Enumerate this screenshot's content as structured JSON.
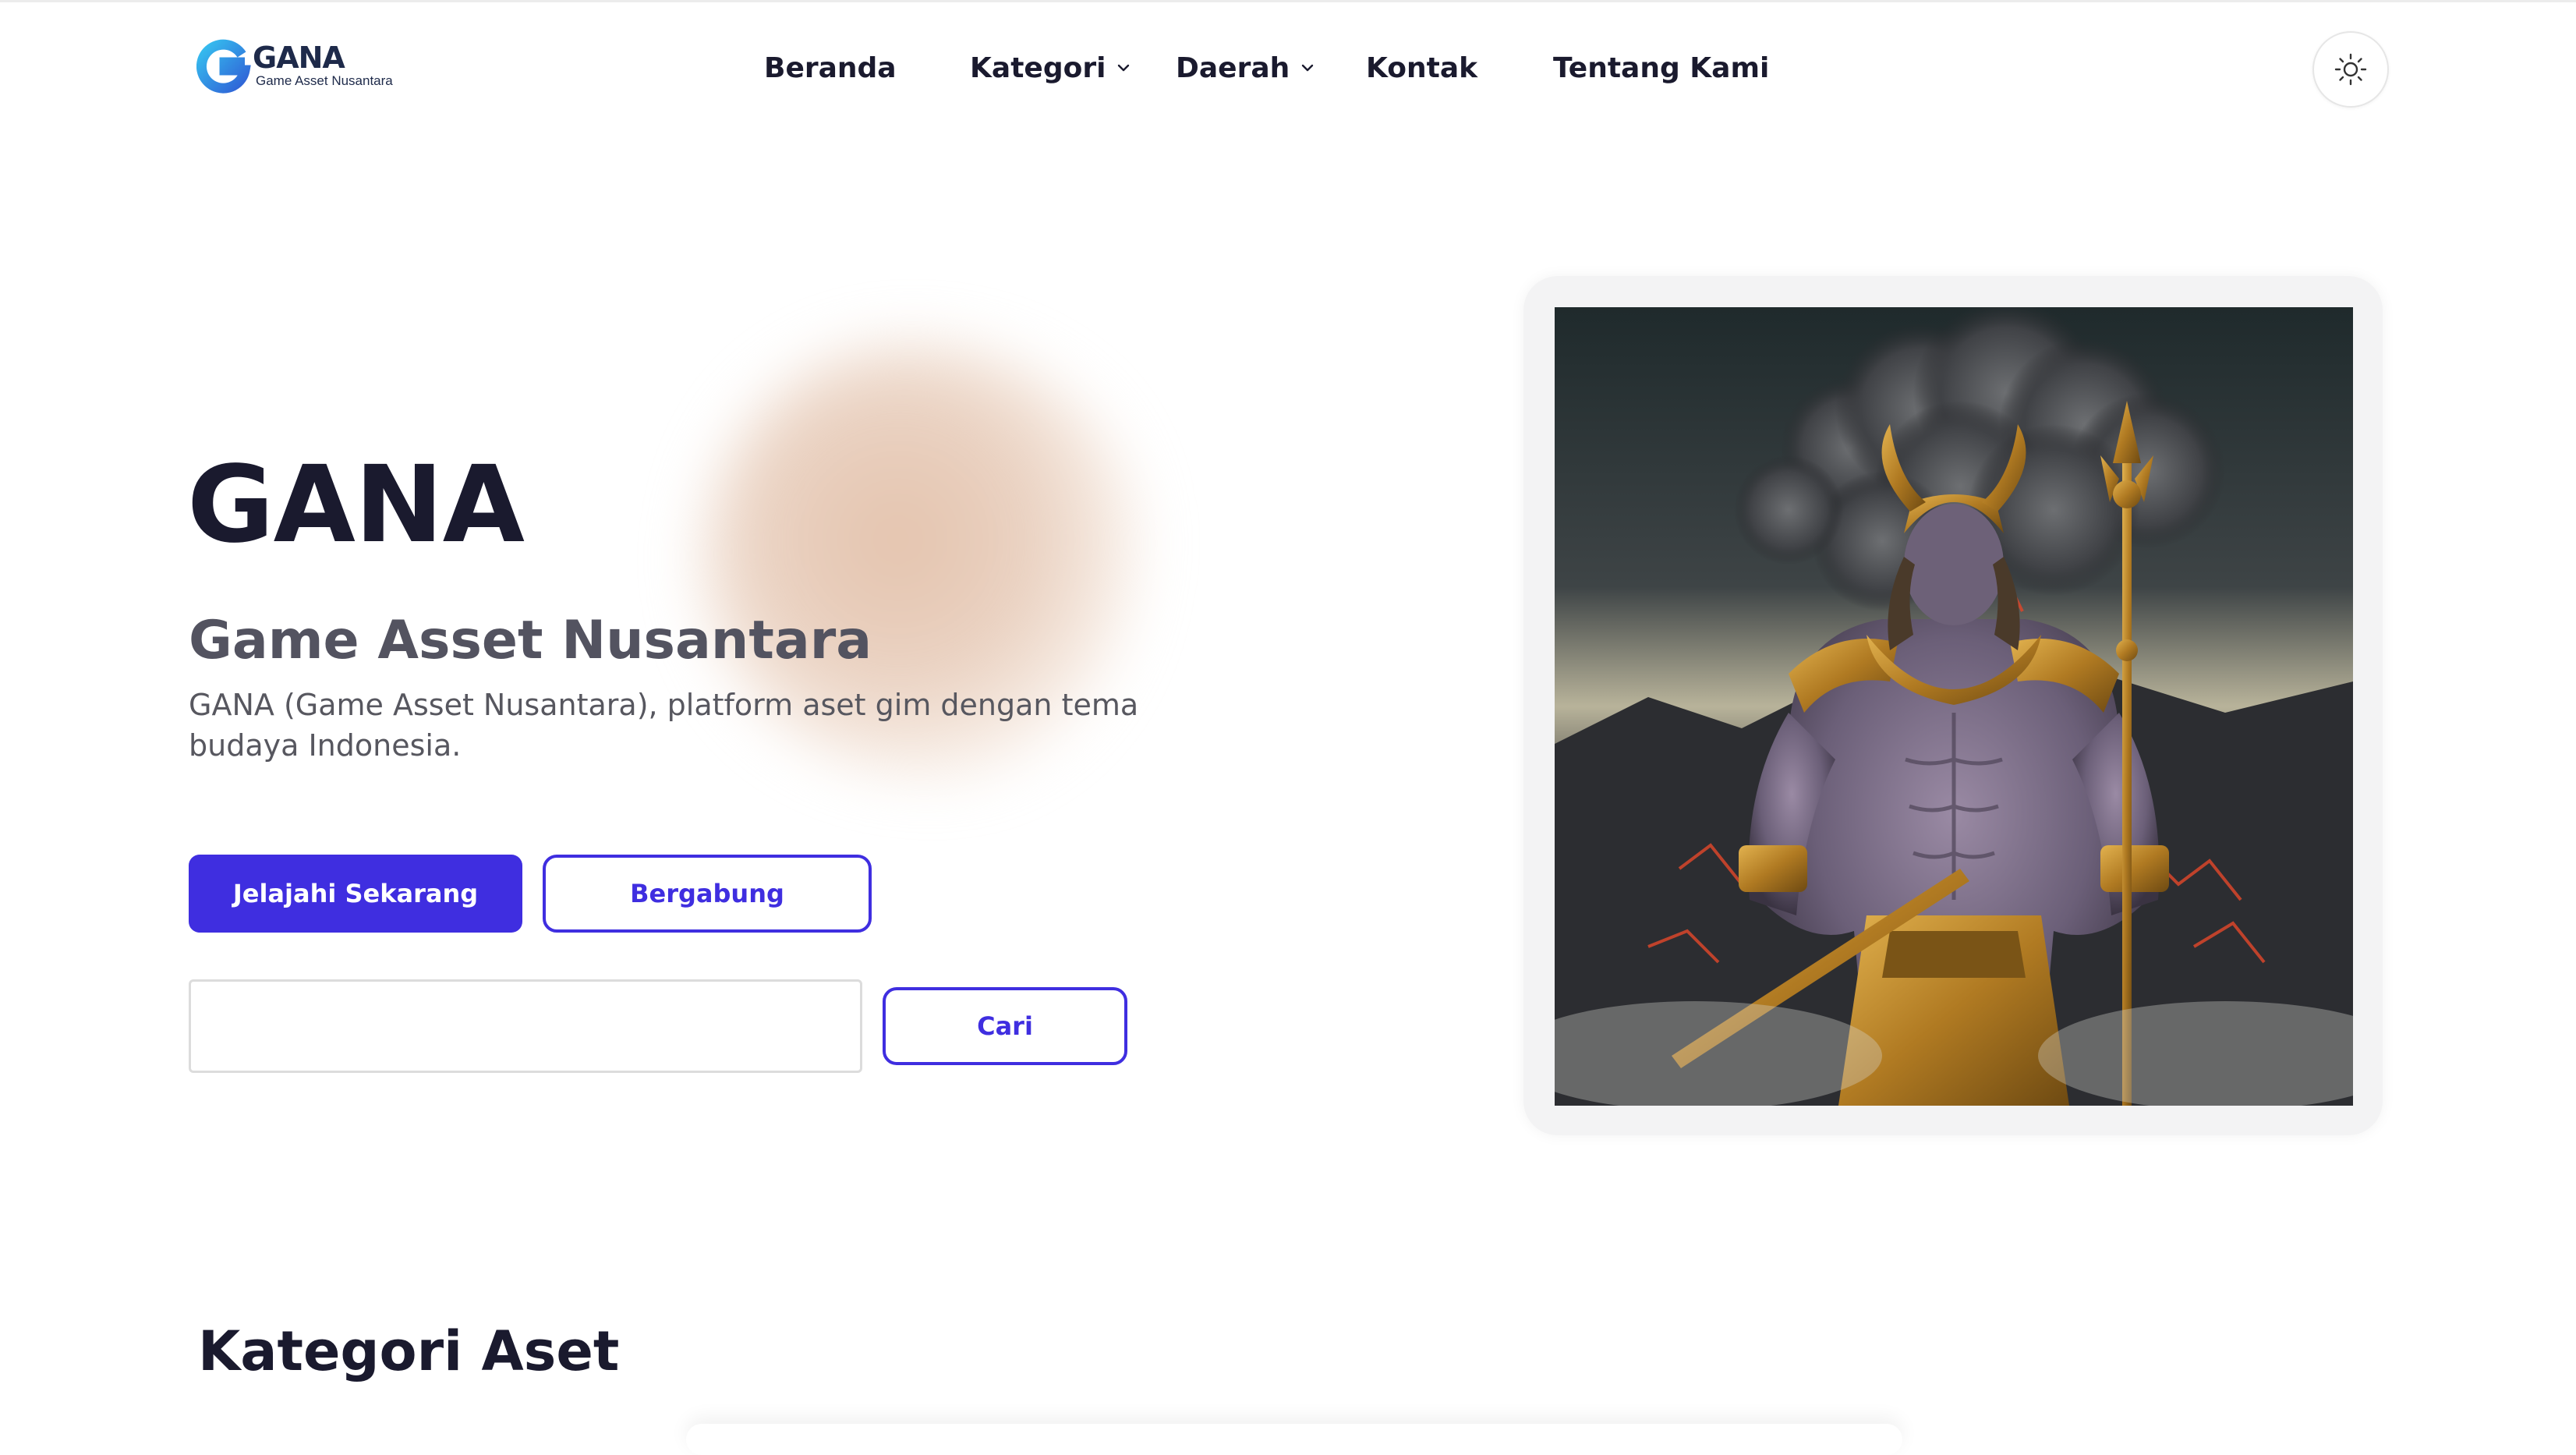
{
  "brand": {
    "name": "GANA",
    "tagline": "Game Asset Nusantara",
    "logo_icon": "g-logo-icon",
    "accent_color": "#3f2ee0"
  },
  "nav": {
    "items": [
      {
        "label": "Beranda",
        "dropdown": false
      },
      {
        "label": "Kategori",
        "dropdown": true
      },
      {
        "label": "Daerah",
        "dropdown": true
      },
      {
        "label": "Kontak",
        "dropdown": false
      },
      {
        "label": "Tentang Kami",
        "dropdown": false
      }
    ],
    "theme_toggle_icon": "sun-icon"
  },
  "hero": {
    "title": "GANA",
    "subtitle": "Game Asset Nusantara",
    "description": "GANA (Game Asset Nusantara), platform aset gim dengan tema budaya Indonesia.",
    "primary_button": "Jelajahi Sekarang",
    "secondary_button": "Bergabung",
    "search": {
      "value": "",
      "placeholder": "",
      "button": "Cari"
    },
    "image": "warrior-illustration"
  },
  "sections": {
    "categories_title": "Kategori Aset"
  }
}
